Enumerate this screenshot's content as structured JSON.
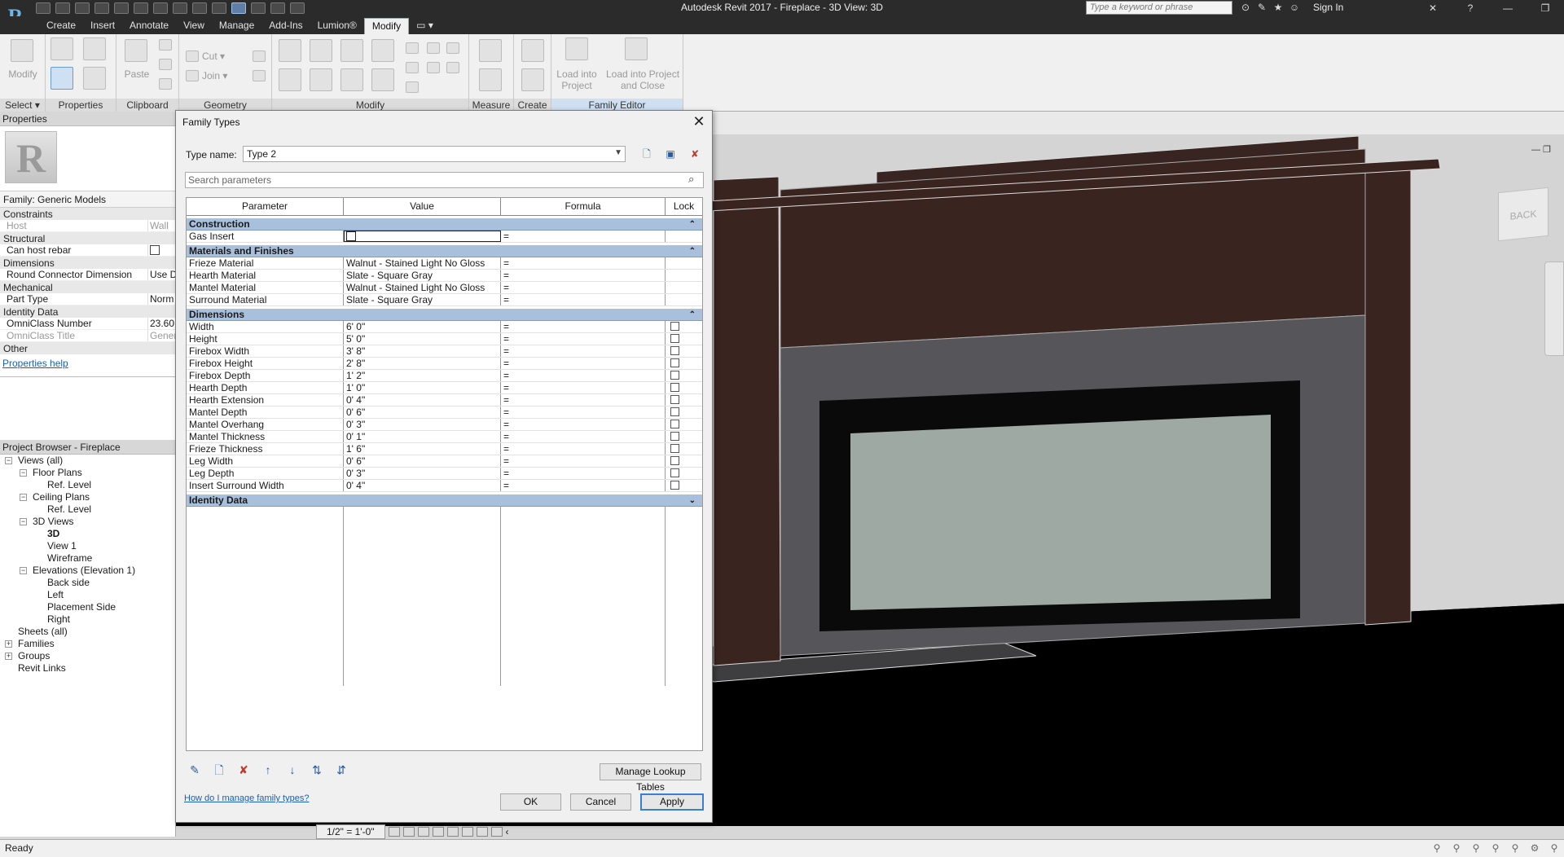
{
  "app": {
    "logo": "R",
    "title": "Autodesk Revit 2017 -     Fireplace - 3D View: 3D",
    "search_placeholder": "Type a keyword or phrase",
    "signin": "Sign In"
  },
  "menu": {
    "tabs": [
      "Create",
      "Insert",
      "Annotate",
      "View",
      "Manage",
      "Add-Ins",
      "Lumion®",
      "Modify"
    ],
    "active": "Modify"
  },
  "ribbon": {
    "select_label": "Select ▾",
    "modify_label": "Modify",
    "paste_label": "Paste",
    "cut_label": "Cut ▾",
    "join_label": "Join ▾",
    "load_into_project": "Load into Project",
    "load_into_project_close": "Load into Project and Close",
    "panels": [
      "Properties",
      "Clipboard",
      "Geometry",
      "Modify",
      "Measure",
      "Create",
      "Family Editor"
    ]
  },
  "properties": {
    "header": "Properties",
    "family": "Family: Generic Models",
    "groups": {
      "constraints": "Constraints",
      "structural": "Structural",
      "dimensions": "Dimensions",
      "mechanical": "Mechanical",
      "identity": "Identity Data",
      "other": "Other"
    },
    "rows": {
      "host": {
        "k": "Host",
        "v": "Wall"
      },
      "can_host_rebar": {
        "k": "Can host rebar"
      },
      "round_connector": {
        "k": "Round Connector Dimension",
        "v": "Use D"
      },
      "part_type": {
        "k": "Part Type",
        "v": "Norm"
      },
      "omniclass_number": {
        "k": "OmniClass Number",
        "v": "23.60."
      },
      "omniclass_title": {
        "k": "OmniClass Title",
        "v": "Gener"
      }
    },
    "help": "Properties help"
  },
  "browser": {
    "header": "Project Browser - Fireplace",
    "items": [
      {
        "label": "Views (all)",
        "level": 0,
        "toggle": "−"
      },
      {
        "label": "Floor Plans",
        "level": 1,
        "toggle": "−"
      },
      {
        "label": "Ref. Level",
        "level": 2
      },
      {
        "label": "Ceiling Plans",
        "level": 1,
        "toggle": "−"
      },
      {
        "label": "Ref. Level",
        "level": 2
      },
      {
        "label": "3D Views",
        "level": 1,
        "toggle": "−"
      },
      {
        "label": "3D",
        "level": 2,
        "bold": true
      },
      {
        "label": "View 1",
        "level": 2
      },
      {
        "label": "Wireframe",
        "level": 2
      },
      {
        "label": "Elevations (Elevation 1)",
        "level": 1,
        "toggle": "−"
      },
      {
        "label": "Back side",
        "level": 2
      },
      {
        "label": "Left",
        "level": 2
      },
      {
        "label": "Placement Side",
        "level": 2
      },
      {
        "label": "Right",
        "level": 2
      },
      {
        "label": "Sheets (all)",
        "level": 0
      },
      {
        "label": "Families",
        "level": 0,
        "toggle": "+"
      },
      {
        "label": "Groups",
        "level": 0,
        "toggle": "+"
      },
      {
        "label": "Revit Links",
        "level": 0
      }
    ]
  },
  "dialog": {
    "title": "Family Types",
    "type_name_label": "Type name:",
    "type_name_value": "Type 2",
    "search_placeholder": "Search parameters",
    "columns": [
      "Parameter",
      "Value",
      "Formula",
      "Lock"
    ],
    "groups": [
      {
        "name": "Construction",
        "chev": "⌃",
        "rows": [
          {
            "param": "Gas Insert",
            "value": "",
            "formula": "=",
            "checkbox": true,
            "lock": false
          }
        ]
      },
      {
        "name": "Materials and Finishes",
        "chev": "⌃",
        "rows": [
          {
            "param": "Frieze Material",
            "value": "Walnut - Stained Light No Gloss",
            "formula": "=",
            "lock": false
          },
          {
            "param": "Hearth Material",
            "value": "Slate - Square Gray",
            "formula": "=",
            "lock": false
          },
          {
            "param": "Mantel Material",
            "value": "Walnut - Stained Light No Gloss",
            "formula": "=",
            "lock": false
          },
          {
            "param": "Surround Material",
            "value": "Slate - Square Gray",
            "formula": "=",
            "lock": false
          }
        ]
      },
      {
        "name": "Dimensions",
        "chev": "⌃",
        "rows": [
          {
            "param": "Width",
            "value": "6'  0\"",
            "formula": "=",
            "lock": true
          },
          {
            "param": "Height",
            "value": "5'  0\"",
            "formula": "=",
            "lock": true
          },
          {
            "param": "Firebox Width",
            "value": "3'  8\"",
            "formula": "=",
            "lock": true
          },
          {
            "param": "Firebox Height",
            "value": "2'  8\"",
            "formula": "=",
            "lock": true
          },
          {
            "param": "Firebox Depth",
            "value": "1'  2\"",
            "formula": "=",
            "lock": true
          },
          {
            "param": "Hearth Depth",
            "value": "1'  0\"",
            "formula": "=",
            "lock": true
          },
          {
            "param": "Hearth Extension",
            "value": "0'  4\"",
            "formula": "=",
            "lock": true
          },
          {
            "param": "Mantel Depth",
            "value": "0'  6\"",
            "formula": "=",
            "lock": true
          },
          {
            "param": "Mantel Overhang",
            "value": "0'  3\"",
            "formula": "=",
            "lock": true
          },
          {
            "param": "Mantel Thickness",
            "value": "0'  1\"",
            "formula": "=",
            "lock": true
          },
          {
            "param": "Frieze Thickness",
            "value": "1'  6\"",
            "formula": "=",
            "lock": true
          },
          {
            "param": "Leg Width",
            "value": "0'  6\"",
            "formula": "=",
            "lock": true
          },
          {
            "param": "Leg Depth",
            "value": "0'  3\"",
            "formula": "=",
            "lock": true
          },
          {
            "param": "Insert Surround Width",
            "value": "0'  4\"",
            "formula": "=",
            "lock": true
          }
        ]
      },
      {
        "name": "Identity Data",
        "chev": "⌄",
        "rows": []
      }
    ],
    "manage_lookup": "Manage Lookup Tables",
    "help_link": "How do I manage family types?",
    "ok": "OK",
    "cancel": "Cancel",
    "apply": "Apply"
  },
  "viewport": {
    "scale": "1/2\" = 1'-0\"",
    "viewcube_label": "BACK"
  },
  "status": {
    "text": "Ready"
  },
  "colors": {
    "accent": "#a9c0dc",
    "frieze_wood": "#3b2420",
    "slate": "#4a4a4e",
    "firebox_glass": "#9ea9a3"
  }
}
